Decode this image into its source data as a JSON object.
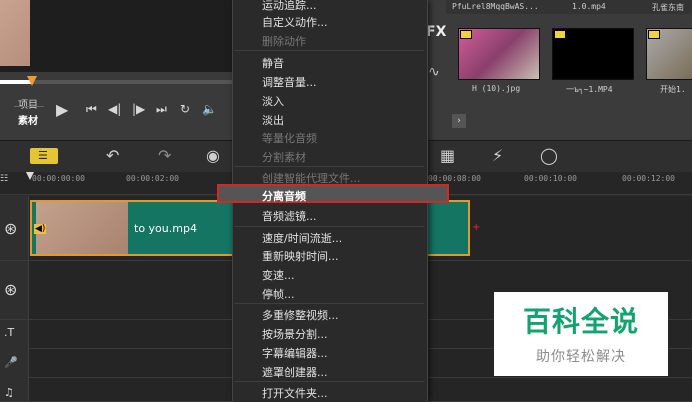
{
  "menu": {
    "items": [
      {
        "label": "运动追踪...",
        "disabled": false
      },
      {
        "label": "自定义动作...",
        "disabled": false
      },
      {
        "label": "删除动作",
        "disabled": true
      },
      {
        "label": "静音",
        "disabled": false
      },
      {
        "label": "调整音量...",
        "disabled": false
      },
      {
        "label": "淡入",
        "disabled": false
      },
      {
        "label": "淡出",
        "disabled": false
      },
      {
        "label": "等量化音频",
        "disabled": true
      },
      {
        "label": "分割素材",
        "disabled": true
      },
      {
        "label": "创建智能代理文件...",
        "disabled": true
      },
      {
        "label": "分离音频",
        "disabled": false,
        "highlighted": true
      },
      {
        "label": "音频滤镜...",
        "disabled": false
      },
      {
        "label": "速度/时间流逝...",
        "disabled": false
      },
      {
        "label": "重新映射时间...",
        "disabled": false
      },
      {
        "label": "变速...",
        "disabled": false
      },
      {
        "label": "停帧...",
        "disabled": false
      },
      {
        "label": "多重修整视频...",
        "disabled": false
      },
      {
        "label": "按场景分割...",
        "disabled": false
      },
      {
        "label": "字幕编辑器...",
        "disabled": false
      },
      {
        "label": "遮罩创建器...",
        "disabled": false
      },
      {
        "label": "打开文件夹...",
        "disabled": false
      }
    ]
  },
  "preview": {
    "mode_project": "项目",
    "mode_clip": "素材"
  },
  "library": {
    "fx_label": "FX",
    "thumbs": [
      {
        "name": "PfuLrel8MqqBwAS...",
        "caption": "H (10).jpg"
      },
      {
        "name": "1.0.mp4",
        "caption": "一ъ┐~1.MP4"
      },
      {
        "name": "孔雀东南",
        "caption": "开始1."
      }
    ]
  },
  "timeline": {
    "ruler": [
      "00:00:00:00",
      "00:00:02:00",
      "00:00:08:00",
      "00:00:10:00",
      "00:00:12:00"
    ],
    "clip_label": "to you.mp4",
    "clip_audio_badge": "◀)"
  },
  "watermark": {
    "title": "百科全说",
    "subtitle": "助你轻松解决"
  },
  "colors": {
    "clip": "#137562",
    "clip_border": "#e39a2c",
    "highlight_border": "#d62727",
    "watermark_green": "#13a36e"
  }
}
